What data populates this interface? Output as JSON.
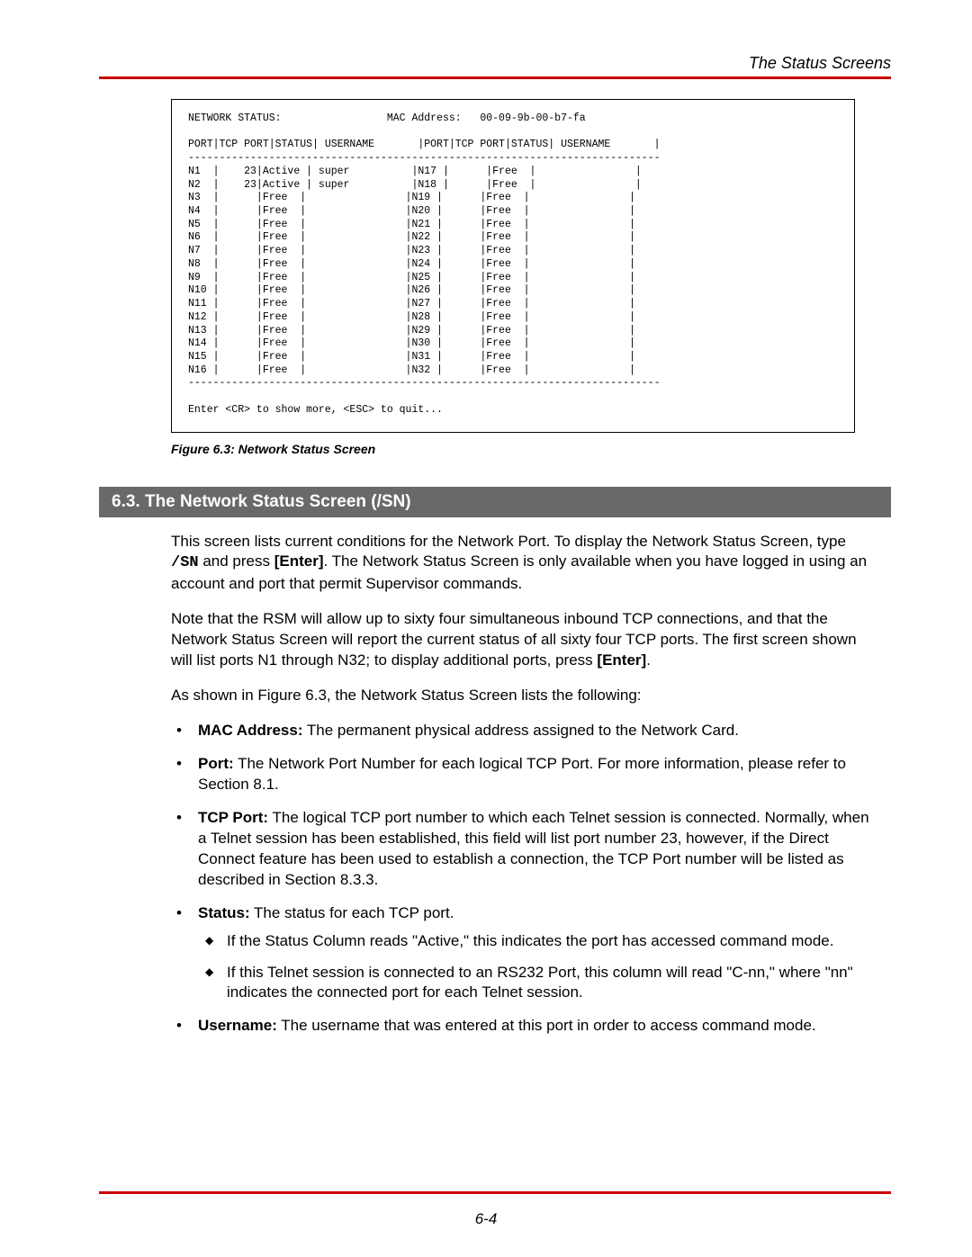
{
  "header": {
    "running": "The Status Screens",
    "page": "6-4"
  },
  "terminal": {
    "title": "NETWORK STATUS:",
    "mac_label": "MAC Address:",
    "mac": "00-09-9b-00-b7-fa",
    "cols": "PORT|TCP PORT|STATUS| USERNAME       |PORT|TCP PORT|STATUS| USERNAME       |",
    "divider": "----------------------------------------------------------------------------",
    "rows": [
      {
        "l": "N1",
        "ltcp": "23",
        "lstat": "Active",
        "luser": "super",
        "r": "N17",
        "rstat": "Free"
      },
      {
        "l": "N2",
        "ltcp": "23",
        "lstat": "Active",
        "luser": "super",
        "r": "N18",
        "rstat": "Free"
      },
      {
        "l": "N3",
        "lstat": "Free",
        "r": "N19",
        "rstat": "Free"
      },
      {
        "l": "N4",
        "lstat": "Free",
        "r": "N20",
        "rstat": "Free"
      },
      {
        "l": "N5",
        "lstat": "Free",
        "r": "N21",
        "rstat": "Free"
      },
      {
        "l": "N6",
        "lstat": "Free",
        "r": "N22",
        "rstat": "Free"
      },
      {
        "l": "N7",
        "lstat": "Free",
        "r": "N23",
        "rstat": "Free"
      },
      {
        "l": "N8",
        "lstat": "Free",
        "r": "N24",
        "rstat": "Free"
      },
      {
        "l": "N9",
        "lstat": "Free",
        "r": "N25",
        "rstat": "Free"
      },
      {
        "l": "N10",
        "lstat": "Free",
        "r": "N26",
        "rstat": "Free"
      },
      {
        "l": "N11",
        "lstat": "Free",
        "r": "N27",
        "rstat": "Free"
      },
      {
        "l": "N12",
        "lstat": "Free",
        "r": "N28",
        "rstat": "Free"
      },
      {
        "l": "N13",
        "lstat": "Free",
        "r": "N29",
        "rstat": "Free"
      },
      {
        "l": "N14",
        "lstat": "Free",
        "r": "N30",
        "rstat": "Free"
      },
      {
        "l": "N15",
        "lstat": "Free",
        "r": "N31",
        "rstat": "Free"
      },
      {
        "l": "N16",
        "lstat": "Free",
        "r": "N32",
        "rstat": "Free"
      }
    ],
    "prompt": "Enter <CR> to show more, <ESC> to quit..."
  },
  "figure": "Figure 6.3:  Network Status Screen",
  "section": "6.3.  The Network Status Screen  (/SN)",
  "para1_a": "This screen lists current conditions for the Network Port.  To display the Network Status Screen, type ",
  "para1_cmd": "/SN",
  "para1_b": " and press ",
  "para1_enter": "[Enter]",
  "para1_c": ".  The Network Status Screen is only available when you have logged in using an account and port that permit Supervisor commands.",
  "para2_a": "Note that the RSM will allow up to sixty four simultaneous inbound TCP connections, and that the Network Status Screen will report the current status of all sixty four TCP ports.  The first screen shown will list ports N1 through N32; to display additional ports, press ",
  "para2_enter": "[Enter]",
  "para2_b": ".",
  "para3": "As shown in Figure 6.3, the Network Status Screen lists the following:",
  "bullets": {
    "mac": {
      "label": "MAC Address:",
      "text": "  The permanent physical address assigned to the Network Card."
    },
    "port": {
      "label": "Port:",
      "text": "  The Network Port Number for each logical TCP Port.  For more information, please refer to Section 8.1."
    },
    "tcp": {
      "label": "TCP Port:",
      "text": "  The logical TCP port number to which each Telnet session is connected.  Normally, when a Telnet session has been established, this field will list port number 23, however, if the Direct Connect feature has been used to establish a connection, the TCP Port number will be listed as described in Section 8.3.3."
    },
    "status": {
      "label": "Status:",
      "text": "  The status for each TCP port.",
      "sub1": "If the Status Column reads \"Active,\" this indicates the port has accessed command mode.",
      "sub2": "If this Telnet session is connected to an RS232 Port, this column will read \"C-nn,\" where \"nn\" indicates the connected port for each Telnet session."
    },
    "user": {
      "label": "Username:",
      "text": "  The username that was entered at this port in order to access command mode."
    }
  }
}
